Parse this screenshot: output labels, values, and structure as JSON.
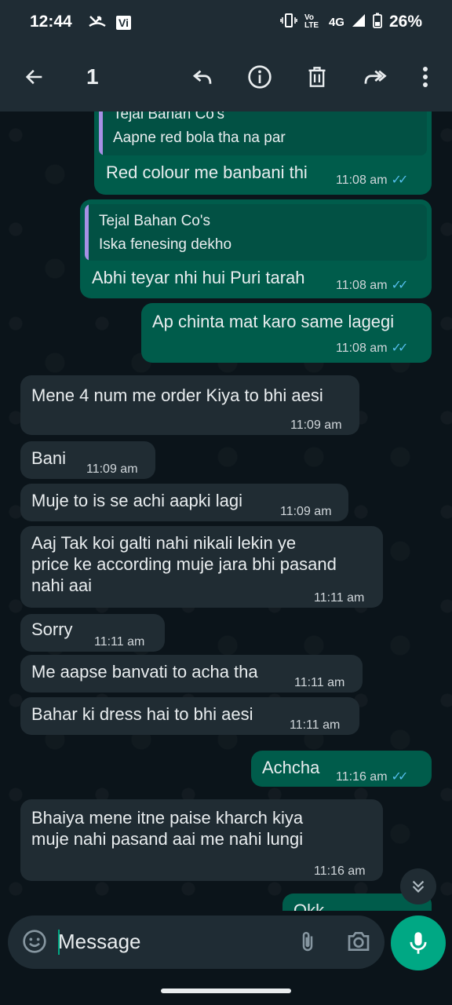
{
  "status_bar": {
    "time": "12:44",
    "carrier_badge": "Vi",
    "network": "4G",
    "volte": "Vo LTE",
    "battery_percent": "26%"
  },
  "toolbar": {
    "selected_count": "1",
    "icons": [
      "back-arrow-icon",
      "reply-icon",
      "info-icon",
      "delete-icon",
      "forward-icon",
      "more-vert-icon"
    ]
  },
  "messages": [
    {
      "dir": "out",
      "quote_name": "Tejal Bahan Co's",
      "quote_text": "Aapne red bola tha na par",
      "text": "Red colour me banbani thi",
      "time": "11:08 am",
      "read": true
    },
    {
      "dir": "out",
      "quote_name": "Tejal Bahan Co's",
      "quote_text": "Iska fenesing dekho",
      "text": "Abhi teyar nhi hui Puri tarah",
      "time": "11:08 am",
      "read": true
    },
    {
      "dir": "out",
      "text": "Ap chinta mat karo same lagegi",
      "time": "11:08 am",
      "read": true
    },
    {
      "dir": "in",
      "text": "Mene 4 num me order Kiya to bhi aesi",
      "time": "11:09 am"
    },
    {
      "dir": "in",
      "text": "Bani",
      "time": "11:09 am"
    },
    {
      "dir": "in",
      "text": "Muje to is se achi aapki lagi",
      "time": "11:09 am"
    },
    {
      "dir": "in",
      "text_lines": [
        "Aaj Tak koi galti nahi nikali lekin ye",
        "price ke according muje jara bhi pasand",
        "nahi aai"
      ],
      "time": "11:11 am"
    },
    {
      "dir": "in",
      "text": "Sorry",
      "time": "11:11 am"
    },
    {
      "dir": "in",
      "text": "Me aapse banvati to acha tha",
      "time": "11:11 am"
    },
    {
      "dir": "in",
      "text": "Bahar ki dress hai to bhi aesi",
      "time": "11:11 am"
    },
    {
      "dir": "out",
      "text": "Achcha",
      "time": "11:16 am",
      "read": true
    },
    {
      "dir": "in",
      "text_lines": [
        "Bhaiya mene itne paise kharch kiya",
        "muje nahi pasand aai me nahi lungi"
      ],
      "time": "11:16 am"
    },
    {
      "dir": "out",
      "text": "Okk",
      "partial": true
    }
  ],
  "input": {
    "placeholder": "Message"
  },
  "colors": {
    "outgoing_bubble": "#005c4b",
    "incoming_bubble": "#202c33",
    "accent": "#00a884",
    "read_ticks": "#53bdeb"
  }
}
